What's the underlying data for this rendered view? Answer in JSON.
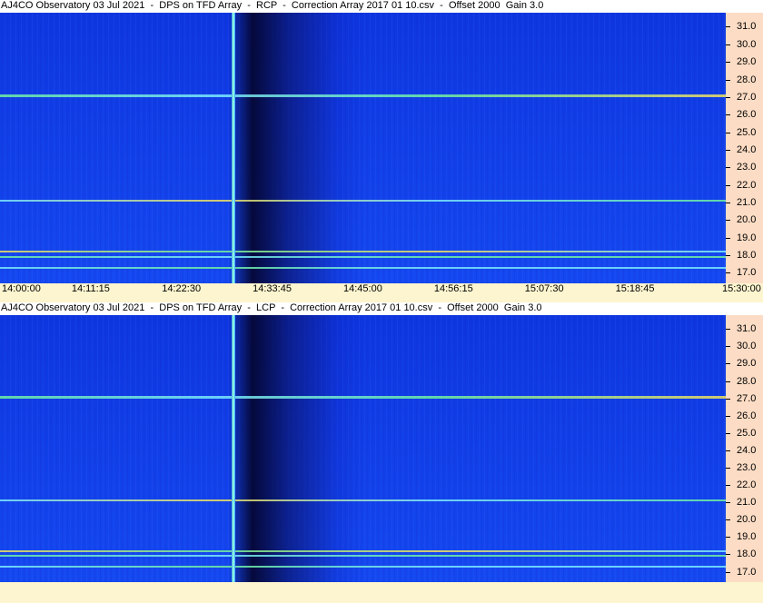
{
  "chart_data": [
    {
      "type": "heatmap",
      "title": "AJ4CO Observatory 03 Jul 2021  -  DPS on TFD Array  -  RCP  -  Correction Array 2017 01 10.csv  -  Offset 2000  Gain 3.0",
      "polarization": "RCP",
      "x_ticks": [
        "14:00:00",
        "14:11:15",
        "14:22:30",
        "14:33:45",
        "14:45:00",
        "14:56:15",
        "15:07:30",
        "15:18:45",
        "15:30:00"
      ],
      "y_ticks": [
        "31.0",
        "30.0",
        "29.0",
        "28.0",
        "27.0",
        "26.0",
        "25.0",
        "24.0",
        "23.0",
        "22.0",
        "21.0",
        "20.0",
        "19.0",
        "18.0",
        "17.0"
      ],
      "ylim": [
        16.4,
        31.8
      ],
      "burst_time": "14:29:00",
      "interference_bands_MHz": [
        27.1,
        21.1,
        18.2,
        17.9,
        17.3
      ]
    },
    {
      "type": "heatmap",
      "title": "AJ4CO Observatory 03 Jul 2021  -  DPS on TFD Array  -  LCP  -  Correction Array 2017 01 10.csv  -  Offset 2000  Gain 3.0",
      "polarization": "LCP",
      "x_ticks": [],
      "y_ticks": [
        "31.0",
        "30.0",
        "29.0",
        "28.0",
        "27.0",
        "26.0",
        "25.0",
        "24.0",
        "23.0",
        "22.0",
        "21.0",
        "20.0",
        "19.0",
        "18.0",
        "17.0"
      ],
      "ylim": [
        16.4,
        31.8
      ],
      "burst_time": "14:29:00",
      "interference_bands_MHz": [
        27.1,
        21.1,
        18.2,
        17.9,
        17.3
      ]
    }
  ],
  "colors": {
    "background": "#0f3ee8",
    "band_green": "#6ff0a0",
    "band_yellow": "#f0e060",
    "band_cyan": "#7ae8ff",
    "axis_bg": "#fcdcc4",
    "footer_bg": "#fcf5cf"
  }
}
